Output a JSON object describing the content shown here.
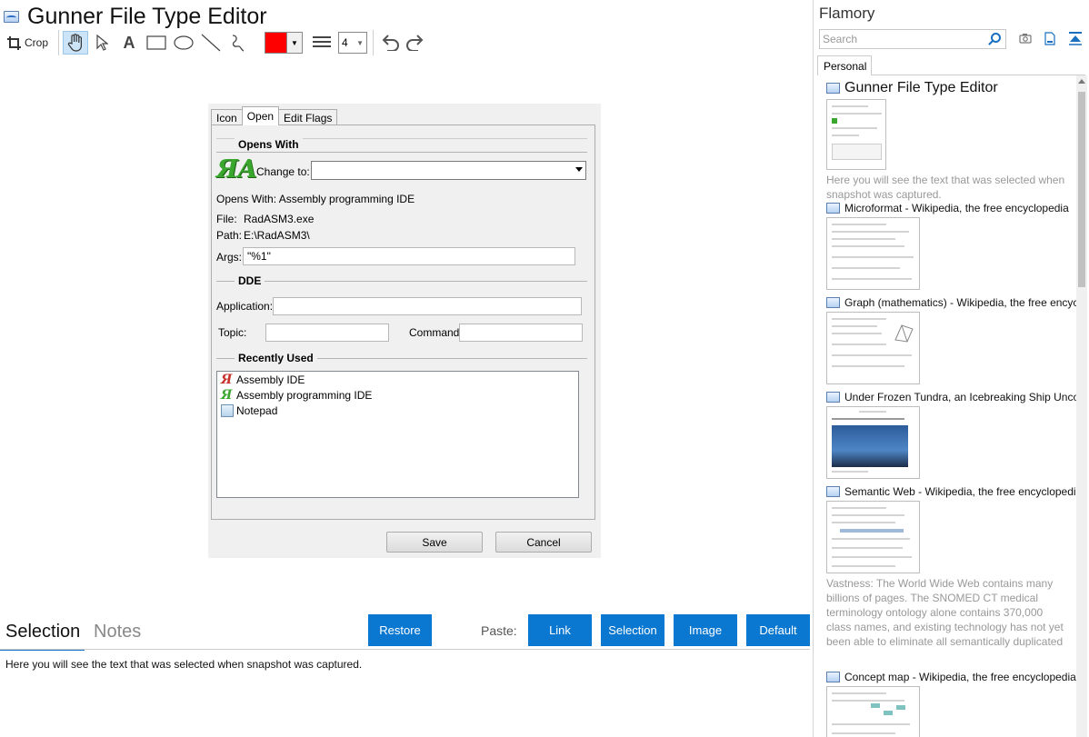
{
  "editor": {
    "title": "Gunner File Type Editor",
    "toolbar": {
      "crop_label": "Crop",
      "stroke_width": "4",
      "color": "#ff0000"
    }
  },
  "dialog": {
    "tabs": [
      "Icon",
      "Open",
      "Edit Flags"
    ],
    "active_tab": "Open",
    "opens_with_group": "Opens With",
    "change_to_label": "Change to:",
    "opens_with_text": "Opens With: Assembly programming IDE",
    "file_label": "File:",
    "file_value": "RadASM3.exe",
    "path_label": "Path:",
    "path_value": "E:\\RadASM3\\",
    "args_label": "Args:",
    "args_value": "\"%1\"",
    "dde_group": "DDE",
    "application_label": "Application:",
    "topic_label": "Topic:",
    "command_label": "Command:",
    "recent_group": "Recently Used",
    "recent_items": [
      "Assembly IDE",
      "Assembly programming IDE",
      "Notepad"
    ],
    "save_label": "Save",
    "cancel_label": "Cancel"
  },
  "bottom": {
    "selection_tab": "Selection",
    "notes_tab": "Notes",
    "restore_label": "Restore",
    "paste_label": "Paste:",
    "link_label": "Link",
    "selection_label": "Selection",
    "image_label": "Image",
    "default_label": "Default",
    "selection_text": "Here you will see the text that was selected when snapshot was captured."
  },
  "sidebar": {
    "title": "Flamory",
    "search_placeholder": "Search",
    "tab": "Personal",
    "items": [
      {
        "title": "Gunner File Type Editor",
        "desc": "Here you will see the text that was selected when snapshot was captured."
      },
      {
        "title": "Microformat - Wikipedia, the free encyclopedia",
        "desc": ""
      },
      {
        "title": "Graph (mathematics) - Wikipedia, the free encyclopedia",
        "desc": ""
      },
      {
        "title": "Under Frozen Tundra, an Icebreaking Ship Uncovers",
        "desc": ""
      },
      {
        "title": "Semantic Web - Wikipedia, the free encyclopedia",
        "desc": "Vastness: The World Wide Web contains many billions of pages. The SNOMED CT medical terminology ontology alone contains 370,000 class names, and existing technology has not yet been able to eliminate all semantically duplicated terms. Any automated reasoning system will have to deal with truly huge inputs."
      },
      {
        "title": "Concept map - Wikipedia, the free encyclopedia",
        "desc": ""
      }
    ]
  },
  "colors": {
    "accent": "#0a78d0",
    "selection_underline": "#1a73c9"
  }
}
